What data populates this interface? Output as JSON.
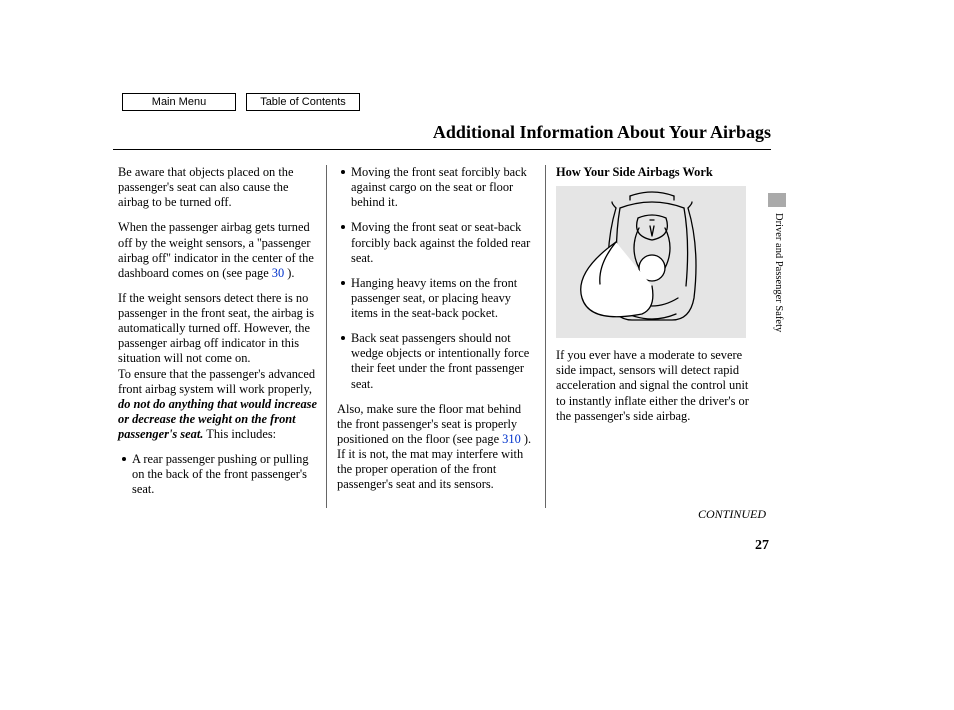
{
  "nav": {
    "main_menu": "Main Menu",
    "toc": "Table of Contents"
  },
  "title": "Additional Information About Your Airbags",
  "col1": {
    "p1": "Be aware that objects placed on the passenger's seat can also cause the airbag to be turned off.",
    "p2a": "When the passenger airbag gets turned off by the weight sensors, a ''passenger airbag off'' indicator in the center of the dashboard comes on (see page ",
    "p2_link": "30",
    "p2b": " ).",
    "p3": "If the weight sensors detect there is no passenger in the front seat, the airbag is automatically turned off. However, the passenger airbag off indicator in this situation will not come on.",
    "p4a": "To ensure that the passenger's advanced front airbag system will work properly, ",
    "p4_bi": "do not do anything that would increase or decrease the weight on the front passenger's seat.",
    "p4b": " This includes:",
    "b1": "A rear passenger pushing or pulling on the back of the front passenger's seat."
  },
  "col2": {
    "b1": "Moving the front seat forcibly back against cargo on the seat or floor behind it.",
    "b2": "Moving the front seat or seat-back forcibly back against the folded rear seat.",
    "b3": "Hanging heavy items on the front passenger seat, or placing heavy items in the seat-back pocket.",
    "b4": "Back seat passengers should not wedge objects or intentionally force their feet under the front passenger seat.",
    "p1a": "Also, make sure the floor mat behind the front passenger's seat is properly positioned on the floor (see page ",
    "p1_link": "310",
    "p1b": " ). If it is not, the mat may interfere with the proper operation of the front passenger's seat and its sensors."
  },
  "col3": {
    "head": "How Your Side Airbags Work",
    "p1": "If you ever have a moderate to severe side impact, sensors will detect rapid acceleration and signal the control unit to instantly inflate either the driver's or the passenger's side airbag."
  },
  "sidebar": "Driver and Passenger Safety",
  "continued": "CONTINUED",
  "page": "27"
}
